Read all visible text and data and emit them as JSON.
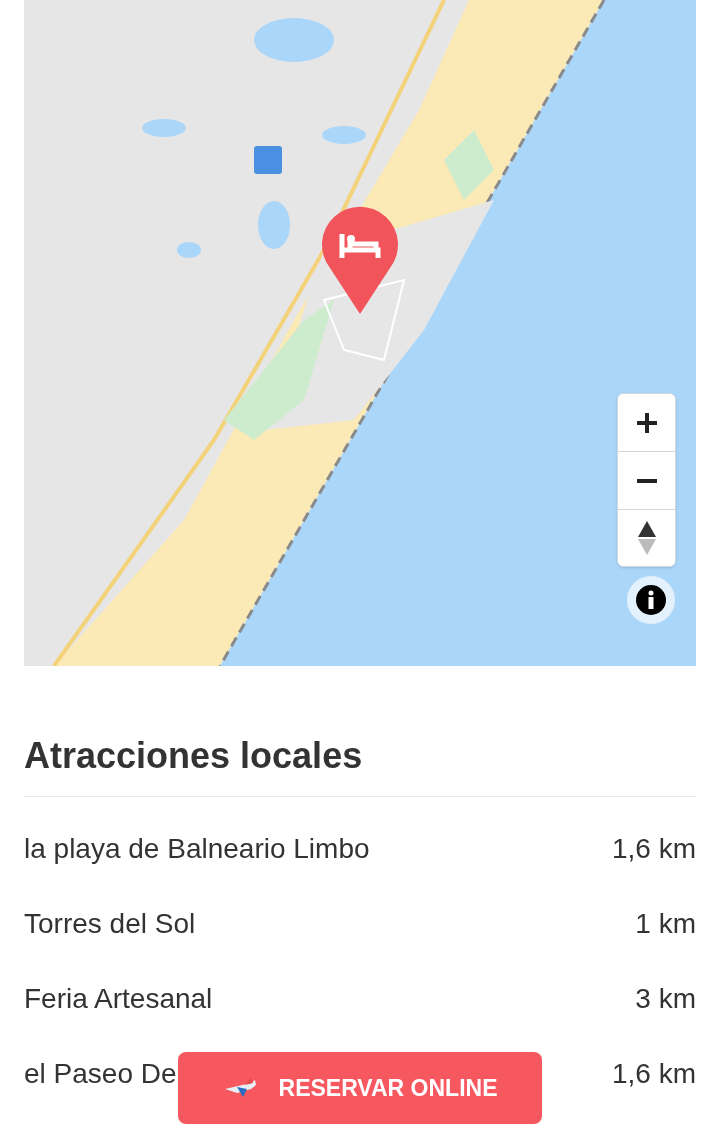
{
  "attractions": {
    "title": "Atracciones locales",
    "items": [
      {
        "name": "la playa de Balneario Limbo",
        "distance": "1,6 km"
      },
      {
        "name": "Torres del Sol",
        "distance": "1 km"
      },
      {
        "name": "Feria Artesanal",
        "distance": "3 km"
      },
      {
        "name": "el Paseo De",
        "distance": "1,6 km"
      }
    ]
  },
  "book_button": {
    "label": "RESERVAR ONLINE"
  }
}
